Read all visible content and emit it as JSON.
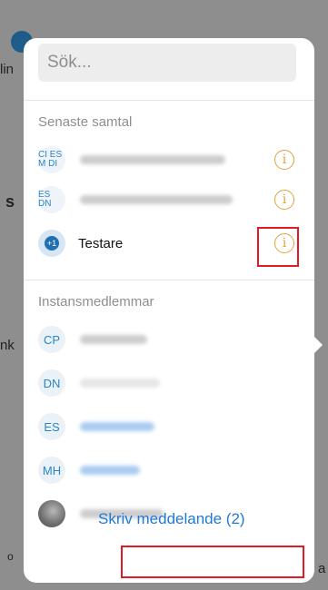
{
  "search": {
    "placeholder": "Sök..."
  },
  "recent": {
    "title": "Senaste samtal",
    "rows": [
      {
        "avatar": "CI ES M DI",
        "name_visible": ""
      },
      {
        "avatar": "ES DN",
        "name_visible": ""
      },
      {
        "avatar": "+1",
        "name_visible": "Testare"
      }
    ]
  },
  "members": {
    "title": "Instansmedlemmar",
    "rows": [
      {
        "avatar": "CP"
      },
      {
        "avatar": "DN"
      },
      {
        "avatar": "ES"
      },
      {
        "avatar": "MH"
      },
      {
        "avatar": ""
      }
    ]
  },
  "compose_button": "Skriv meddelande (2)",
  "background": {
    "left_texts": [
      "lin",
      "s",
      "nk"
    ],
    "bottom_left_glyph": "ο",
    "bottom_right_text": "a"
  },
  "colors": {
    "accent_blue": "#1e7ad6",
    "info_orange": "#e0a13b",
    "highlight_red": "#e01b24"
  }
}
